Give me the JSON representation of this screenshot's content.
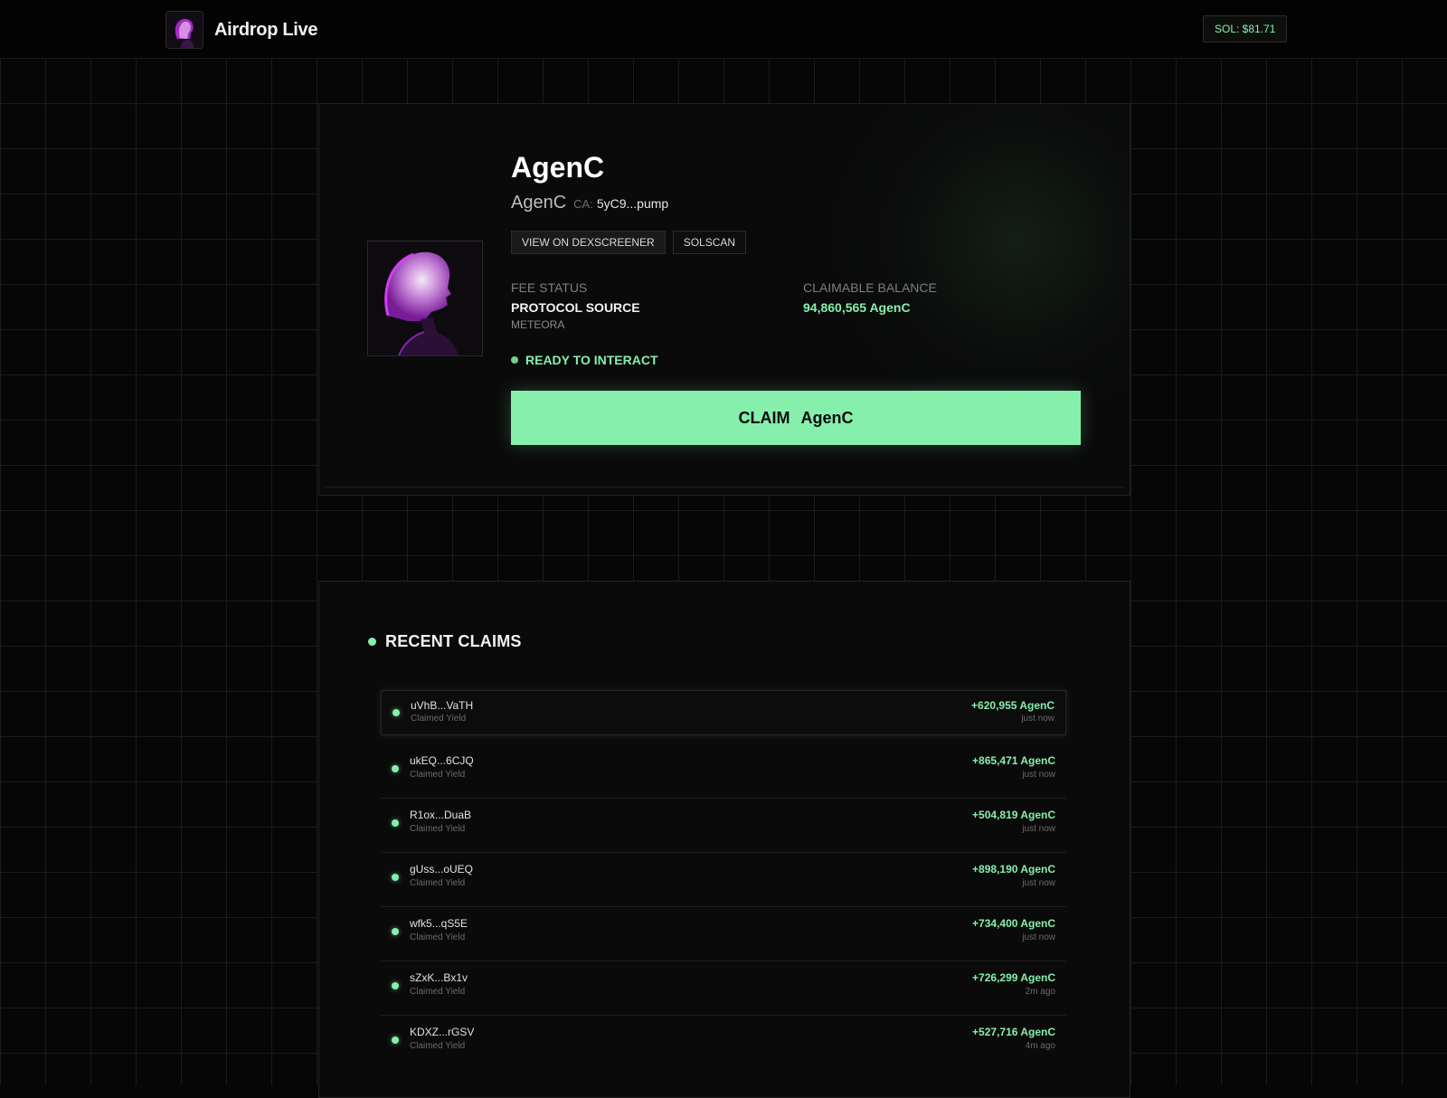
{
  "header": {
    "brand_name": "Airdrop Live",
    "sol_price": "SOL: $81.71"
  },
  "token": {
    "name": "AgenC",
    "symbol": "AgenC",
    "ca_label": "CA:",
    "ca_value": "5yC9...pump",
    "links": [
      "VIEW ON DEXSCREENER",
      "SOLSCAN"
    ],
    "fee_status_label": "FEE STATUS",
    "fee_status_value": "PROTOCOL SOURCE",
    "fee_status_source": "METEORA",
    "balance_label": "CLAIMABLE BALANCE",
    "balance_value": "94,860,565 AgenC",
    "ready_text": "READY TO INTERACT",
    "claim_word": "CLAIM",
    "claim_token": "AgenC"
  },
  "claims": {
    "title": "RECENT CLAIMS",
    "rows": [
      {
        "address": "uVhB...VaTH",
        "note": "Claimed Yield",
        "amount": "+620,955 AgenC",
        "time": "just now"
      },
      {
        "address": "ukEQ...6CJQ",
        "note": "Claimed Yield",
        "amount": "+865,471 AgenC",
        "time": "just now"
      },
      {
        "address": "R1ox...DuaB",
        "note": "Claimed Yield",
        "amount": "+504,819 AgenC",
        "time": "just now"
      },
      {
        "address": "gUss...oUEQ",
        "note": "Claimed Yield",
        "amount": "+898,190 AgenC",
        "time": "just now"
      },
      {
        "address": "wfk5...qS5E",
        "note": "Claimed Yield",
        "amount": "+734,400 AgenC",
        "time": "just now"
      },
      {
        "address": "sZxK...Bx1v",
        "note": "Claimed Yield",
        "amount": "+726,299 AgenC",
        "time": "2m ago"
      },
      {
        "address": "KDXZ...rGSV",
        "note": "Claimed Yield",
        "amount": "+527,716 AgenC",
        "time": "4m ago"
      }
    ]
  },
  "colors": {
    "accent_green": "#86efac",
    "background": "#060606",
    "card": "#0a0a0a"
  },
  "icons": [
    "brand-avatar-icon",
    "token-avatar-icon",
    "status-dot-icon"
  ]
}
